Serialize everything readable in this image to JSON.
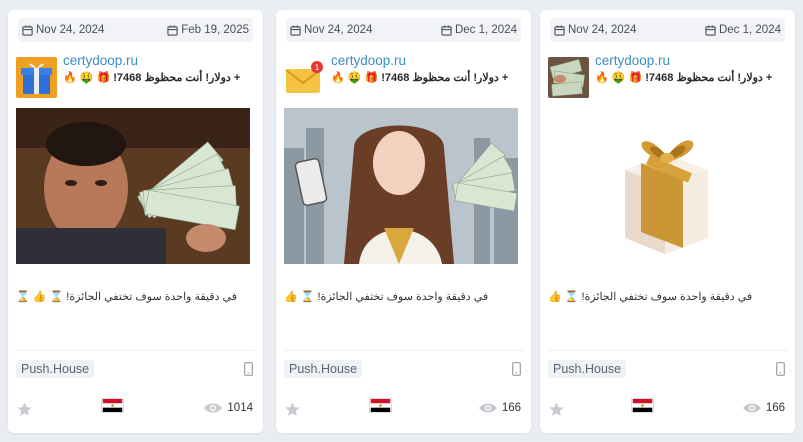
{
  "cards": [
    {
      "start_date": "Nov 24, 2024",
      "end_date": "Feb 19, 2025",
      "domain": "certydoop.ru",
      "title": "🔥 🤑 🎁 !دولار! أنت محظوظ 7468 +",
      "body": "⌛ 👍 ⌛ !في دقيقة واحدة سوف تختفي الجائزة",
      "network": "Push.House",
      "views": "1014",
      "avatar": "gift-box-blue-icon",
      "image": "man-holding-cash-photo"
    },
    {
      "start_date": "Nov 24, 2024",
      "end_date": "Dec 1, 2024",
      "domain": "certydoop.ru",
      "title": "🔥 🤑 🎁 !دولار! أنت محظوظ 7468 +",
      "body": "👍 ⌛ !في دقيقة واحدة سوف تختفي الجائزة",
      "network": "Push.House",
      "views": "166",
      "avatar": "envelope-notification-icon",
      "image": "woman-holding-phone-and-cash-photo"
    },
    {
      "start_date": "Nov 24, 2024",
      "end_date": "Dec 1, 2024",
      "domain": "certydoop.ru",
      "title": "🔥 🤑 🎁 !دولار! أنت محظوظ 7468 +",
      "body": "👍 ⌛ !في دقيقة واحدة سوف تختفي الجائزة",
      "network": "Push.House",
      "views": "166",
      "avatar": "cash-stack-photo",
      "image": "gift-box-gold-ribbon-photo"
    }
  ],
  "colors": {
    "domain": "#3a8ec4",
    "page_bg": "#e9ecf0",
    "badge_bg": "#eef1f6"
  }
}
